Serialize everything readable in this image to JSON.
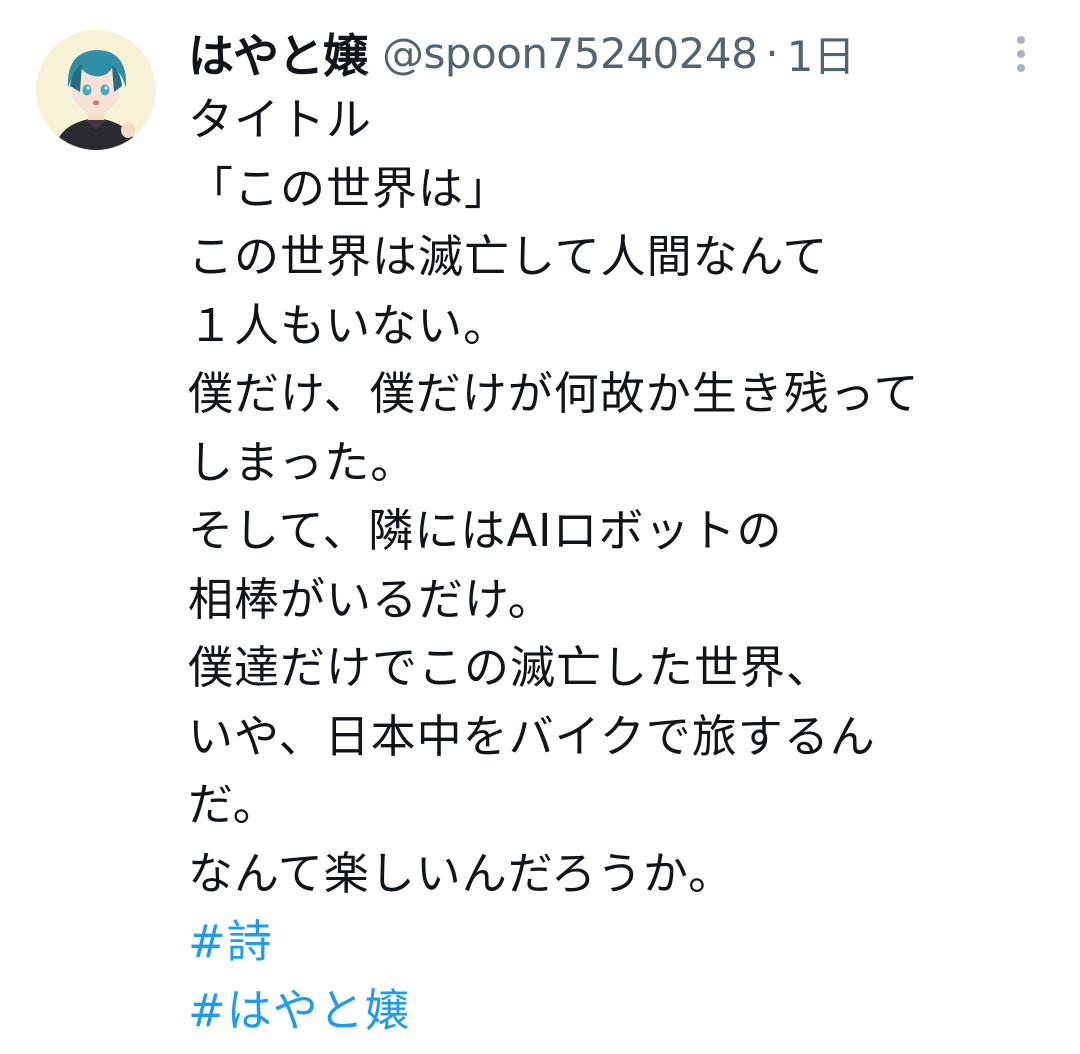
{
  "tweet": {
    "author": {
      "display_name": "はやと嬢",
      "handle": "@spoon75240248",
      "avatar_icon": "user-avatar-anime-illustration"
    },
    "separator": "·",
    "time": "1日",
    "more_icon": "more-vertical-icon",
    "lines": [
      "タイトル",
      "「この世界は」",
      "この世界は滅亡して人間なんて",
      "１人もいない。",
      "僕だけ、僕だけが何故か生き残って",
      "しまった。",
      "そして、隣にはAIロボットの",
      "相棒がいるだけ。",
      "僕達だけでこの滅亡した世界、",
      "いや、日本中をバイクで旅するん",
      "だ。",
      "なんて楽しいんだろうか。"
    ],
    "hashtags": [
      "#詩",
      "#はやと嬢"
    ],
    "colors": {
      "text": "#0f1419",
      "secondary": "#536471",
      "link": "#1d9bf0",
      "background": "#ffffff"
    }
  }
}
